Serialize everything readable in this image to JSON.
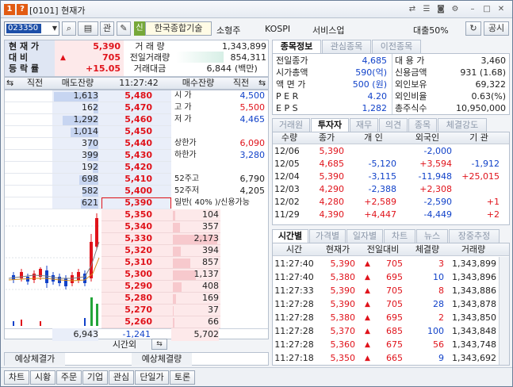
{
  "window": {
    "title": "[0101] 현재가",
    "badges": [
      "1",
      "?"
    ]
  },
  "toolbar": {
    "code": "023350",
    "rel_label": "관",
    "shin_label": "신",
    "company": "한국종합기술",
    "sector": "소형주",
    "market": "KOSPI",
    "industry": "서비스업",
    "loan": "대출50%",
    "notice_btn": "공시"
  },
  "summary": {
    "labels": [
      "현 재 가",
      "대    비",
      "등 락 률"
    ],
    "price": "5,390",
    "change": "705",
    "rate": "+15.05",
    "vol_labels": [
      "거 래 량",
      "전일거래량",
      "거래대금"
    ],
    "volume": "1,343,899",
    "prev_volume": "854,311",
    "amount": "6,844",
    "amount_unit": "(백만)"
  },
  "orderbook": {
    "headers": [
      "직전",
      "매도잔량",
      "11:27:42",
      "매수잔량",
      "직전"
    ],
    "asks": [
      {
        "qty": "1,613",
        "price": "5,480"
      },
      {
        "qty": "162",
        "price": "5,470"
      },
      {
        "qty": "1,292",
        "price": "5,460"
      },
      {
        "qty": "1,014",
        "price": "5,450"
      },
      {
        "qty": "370",
        "price": "5,440"
      },
      {
        "qty": "399",
        "price": "5,430"
      },
      {
        "qty": "192",
        "price": "5,420"
      },
      {
        "qty": "698",
        "price": "5,410"
      },
      {
        "qty": "582",
        "price": "5,400"
      },
      {
        "qty": "621",
        "price": "5,390"
      }
    ],
    "bids": [
      {
        "price": "5,350",
        "qty": "104"
      },
      {
        "price": "5,340",
        "qty": "357"
      },
      {
        "price": "5,330",
        "qty": "2,173"
      },
      {
        "price": "5,320",
        "qty": "394"
      },
      {
        "price": "5,310",
        "qty": "857"
      },
      {
        "price": "5,300",
        "qty": "1,137"
      },
      {
        "price": "5,290",
        "qty": "408"
      },
      {
        "price": "5,280",
        "qty": "169"
      },
      {
        "price": "5,270",
        "qty": "37"
      },
      {
        "price": "5,260",
        "qty": "66"
      }
    ],
    "info": [
      {
        "label": "시  가",
        "value": "4,500",
        "color": "blue"
      },
      {
        "label": "고  가",
        "value": "5,500",
        "color": "red"
      },
      {
        "label": "저  가",
        "value": "4,465",
        "color": "blue"
      },
      {
        "label": "",
        "value": "",
        "color": ""
      },
      {
        "label": "상한가",
        "value": "6,090",
        "color": "red"
      },
      {
        "label": "하한가",
        "value": "3,280",
        "color": "blue"
      },
      {
        "label": "",
        "value": "",
        "color": ""
      },
      {
        "label": "52주고",
        "value": "6,790",
        "color": "black"
      },
      {
        "label": "52주저",
        "value": "4,205",
        "color": "black"
      },
      {
        "label": "일반( 40% )/신용가능",
        "value": "",
        "color": "black"
      }
    ],
    "total_ask": "6,943",
    "total_diff": "-1,241",
    "total_bid": "5,702",
    "after_hours": "시간외"
  },
  "expected": {
    "price_label": "예상체결가",
    "qty_label": "예상체결량"
  },
  "info_tabs": [
    "종목정보",
    "관심종목",
    "이전종목"
  ],
  "stock_info": [
    {
      "l": "전일종가",
      "v": "4,685",
      "l2": "대 용 가",
      "v2": "3,460"
    },
    {
      "l": "시가총액",
      "v": "590(억)",
      "l2": "신용금액",
      "v2": "931  (1.68)"
    },
    {
      "l": "액 면 가",
      "v": "500 (원)",
      "l2": "외인보유",
      "v2": "69,322"
    },
    {
      "l": "P E R",
      "v": "4.20",
      "l2": "외인비율",
      "v2": "0.63(%)"
    },
    {
      "l": "E P S",
      "v": "1,282",
      "l2": "총주식수",
      "v2": "10,950,000"
    }
  ],
  "investor_tabs": [
    "거래원",
    "투자자",
    "재무",
    "의견",
    "종목",
    "체결강도"
  ],
  "investor": {
    "headers": [
      "수량",
      "종가",
      "개 인",
      "외국인",
      "기 관"
    ],
    "rows": [
      {
        "date": "12/06",
        "close": "5,390",
        "indiv": "",
        "foreign": "-2,000",
        "inst": ""
      },
      {
        "date": "12/05",
        "close": "4,685",
        "indiv": "-5,120",
        "foreign": "+3,594",
        "inst": "-1,912"
      },
      {
        "date": "12/04",
        "close": "5,390",
        "indiv": "-3,115",
        "foreign": "-11,948",
        "inst": "+25,015"
      },
      {
        "date": "12/03",
        "close": "4,290",
        "indiv": "-2,388",
        "foreign": "+2,308",
        "inst": ""
      },
      {
        "date": "12/02",
        "close": "4,280",
        "indiv": "+2,589",
        "foreign": "-2,590",
        "inst": "+1"
      },
      {
        "date": "11/29",
        "close": "4,390",
        "indiv": "+4,447",
        "foreign": "-4,449",
        "inst": "+2"
      }
    ]
  },
  "tick_tabs": [
    "시간별",
    "가격별",
    "일자별",
    "차트",
    "뉴스",
    "장중추정"
  ],
  "ticks": {
    "headers": [
      "시간",
      "현재가",
      "전일대비",
      "체결량",
      "거래량"
    ],
    "rows": [
      {
        "time": "11:27:40",
        "price": "5,390",
        "diff": "705",
        "qty": "3",
        "vol": "1,343,899"
      },
      {
        "time": "11:27:40",
        "price": "5,380",
        "diff": "695",
        "qty": "10",
        "vol": "1,343,896"
      },
      {
        "time": "11:27:33",
        "price": "5,390",
        "diff": "705",
        "qty": "8",
        "vol": "1,343,886"
      },
      {
        "time": "11:27:28",
        "price": "5,390",
        "diff": "705",
        "qty": "28",
        "vol": "1,343,878"
      },
      {
        "time": "11:27:28",
        "price": "5,380",
        "diff": "695",
        "qty": "2",
        "vol": "1,343,850"
      },
      {
        "time": "11:27:28",
        "price": "5,370",
        "diff": "685",
        "qty": "100",
        "vol": "1,343,848"
      },
      {
        "time": "11:27:28",
        "price": "5,360",
        "diff": "675",
        "qty": "56",
        "vol": "1,343,748"
      },
      {
        "time": "11:27:18",
        "price": "5,350",
        "diff": "665",
        "qty": "9",
        "vol": "1,343,692"
      }
    ]
  },
  "bottom_buttons": [
    "차트",
    "시황",
    "주문",
    "기업",
    "관심",
    "단일가",
    "토론"
  ],
  "colors": {
    "up": "#e0131b",
    "down": "#1142c9",
    "ask_bg": "#e9eef9",
    "bid_bg": "#fde9ea"
  }
}
